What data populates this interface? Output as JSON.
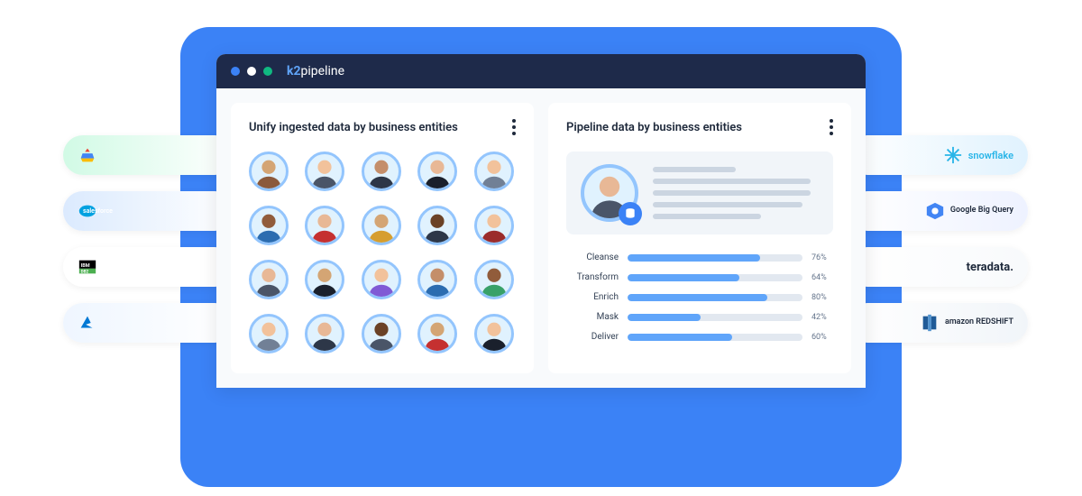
{
  "brand": {
    "prefix": "k2",
    "name": "pipeline"
  },
  "left_card": {
    "title": "Unify ingested data by business entities"
  },
  "right_card": {
    "title": "Pipeline data by business entities",
    "progress": [
      {
        "label": "Cleanse",
        "pct": 76
      },
      {
        "label": "Transform",
        "pct": 64
      },
      {
        "label": "Enrich",
        "pct": 80
      },
      {
        "label": "Mask",
        "pct": 42
      },
      {
        "label": "Deliver",
        "pct": 60
      }
    ]
  },
  "left_pills": [
    {
      "name": "google-cloud",
      "label": ""
    },
    {
      "name": "salesforce",
      "label": "salesforce"
    },
    {
      "name": "ibm-db2",
      "label": "IBM DB2"
    },
    {
      "name": "azure",
      "label": ""
    }
  ],
  "right_pills": [
    {
      "name": "snowflake",
      "label": "snowflake"
    },
    {
      "name": "google-bigquery",
      "label": "Google Big Query"
    },
    {
      "name": "teradata",
      "label": "teradata."
    },
    {
      "name": "amazon-redshift",
      "label": "amazon REDSHIFT"
    }
  ],
  "chart_data": {
    "type": "bar",
    "title": "Pipeline data by business entities",
    "categories": [
      "Cleanse",
      "Transform",
      "Enrich",
      "Mask",
      "Deliver"
    ],
    "values": [
      76,
      64,
      80,
      42,
      60
    ],
    "xlabel": "",
    "ylabel": "percent",
    "ylim": [
      0,
      100
    ]
  }
}
